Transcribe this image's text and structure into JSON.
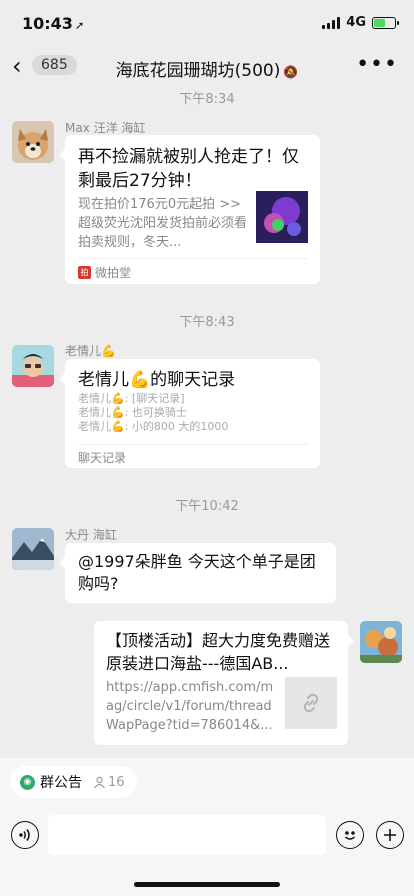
{
  "status": {
    "time": "10:43",
    "network": "4G"
  },
  "nav": {
    "back_count": "685",
    "title": "海底花园珊瑚坊(500)",
    "more": "•••"
  },
  "timestamps": [
    "下午8:34",
    "下午8:43",
    "下午10:42"
  ],
  "messages": [
    {
      "sender": "Max 汪洋 海缸",
      "card_title": "再不捡漏就被别人抢走了！仅剩最后27分钟！",
      "card_desc": "现在拍价176元0元起拍 >> 超级荧光沈阳发货拍前必须看拍卖规则，冬天...",
      "source": "微拍堂"
    },
    {
      "sender": "老情儿💪",
      "record_title": "老情儿💪的聊天记录",
      "record_lines": [
        "老情儿💪: [聊天记录]",
        "老情儿💪: 也可换骑士",
        "老情儿💪: 小的800 大的1000"
      ],
      "record_footer": "聊天记录"
    },
    {
      "sender": "大丹 海缸",
      "text": "@1997朵胖鱼 今天这个单子是团购吗?"
    },
    {
      "card_title": "【顶楼活动】超大力度免费赠送原装进口海盐---德国AB...",
      "card_url": "https://app.cmfish.com/mag/circle/v1/forum/threadWapPage?tid=786014&..."
    }
  ],
  "bottom": {
    "notice_label": "群公告",
    "notice_count": "16"
  },
  "colors": {
    "background": "#ededed",
    "bubble": "#ffffff",
    "accent_green": "#2aae67",
    "battery": "#4cd964"
  }
}
